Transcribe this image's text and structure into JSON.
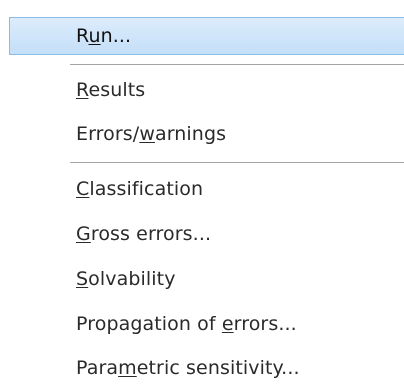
{
  "menu": {
    "items": [
      {
        "pre": "R",
        "key": "u",
        "post": "n..."
      },
      {
        "pre": "",
        "key": "R",
        "post": "esults"
      },
      {
        "pre": "Errors/",
        "key": "w",
        "post": "arnings"
      },
      {
        "pre": "",
        "key": "C",
        "post": "lassification"
      },
      {
        "pre": "",
        "key": "G",
        "post": "ross errors..."
      },
      {
        "pre": "",
        "key": "S",
        "post": "olvability"
      },
      {
        "pre": "Propagation of ",
        "key": "e",
        "post": "rrors..."
      },
      {
        "pre": "Para",
        "key": "m",
        "post": "etric sensitivity..."
      }
    ]
  }
}
